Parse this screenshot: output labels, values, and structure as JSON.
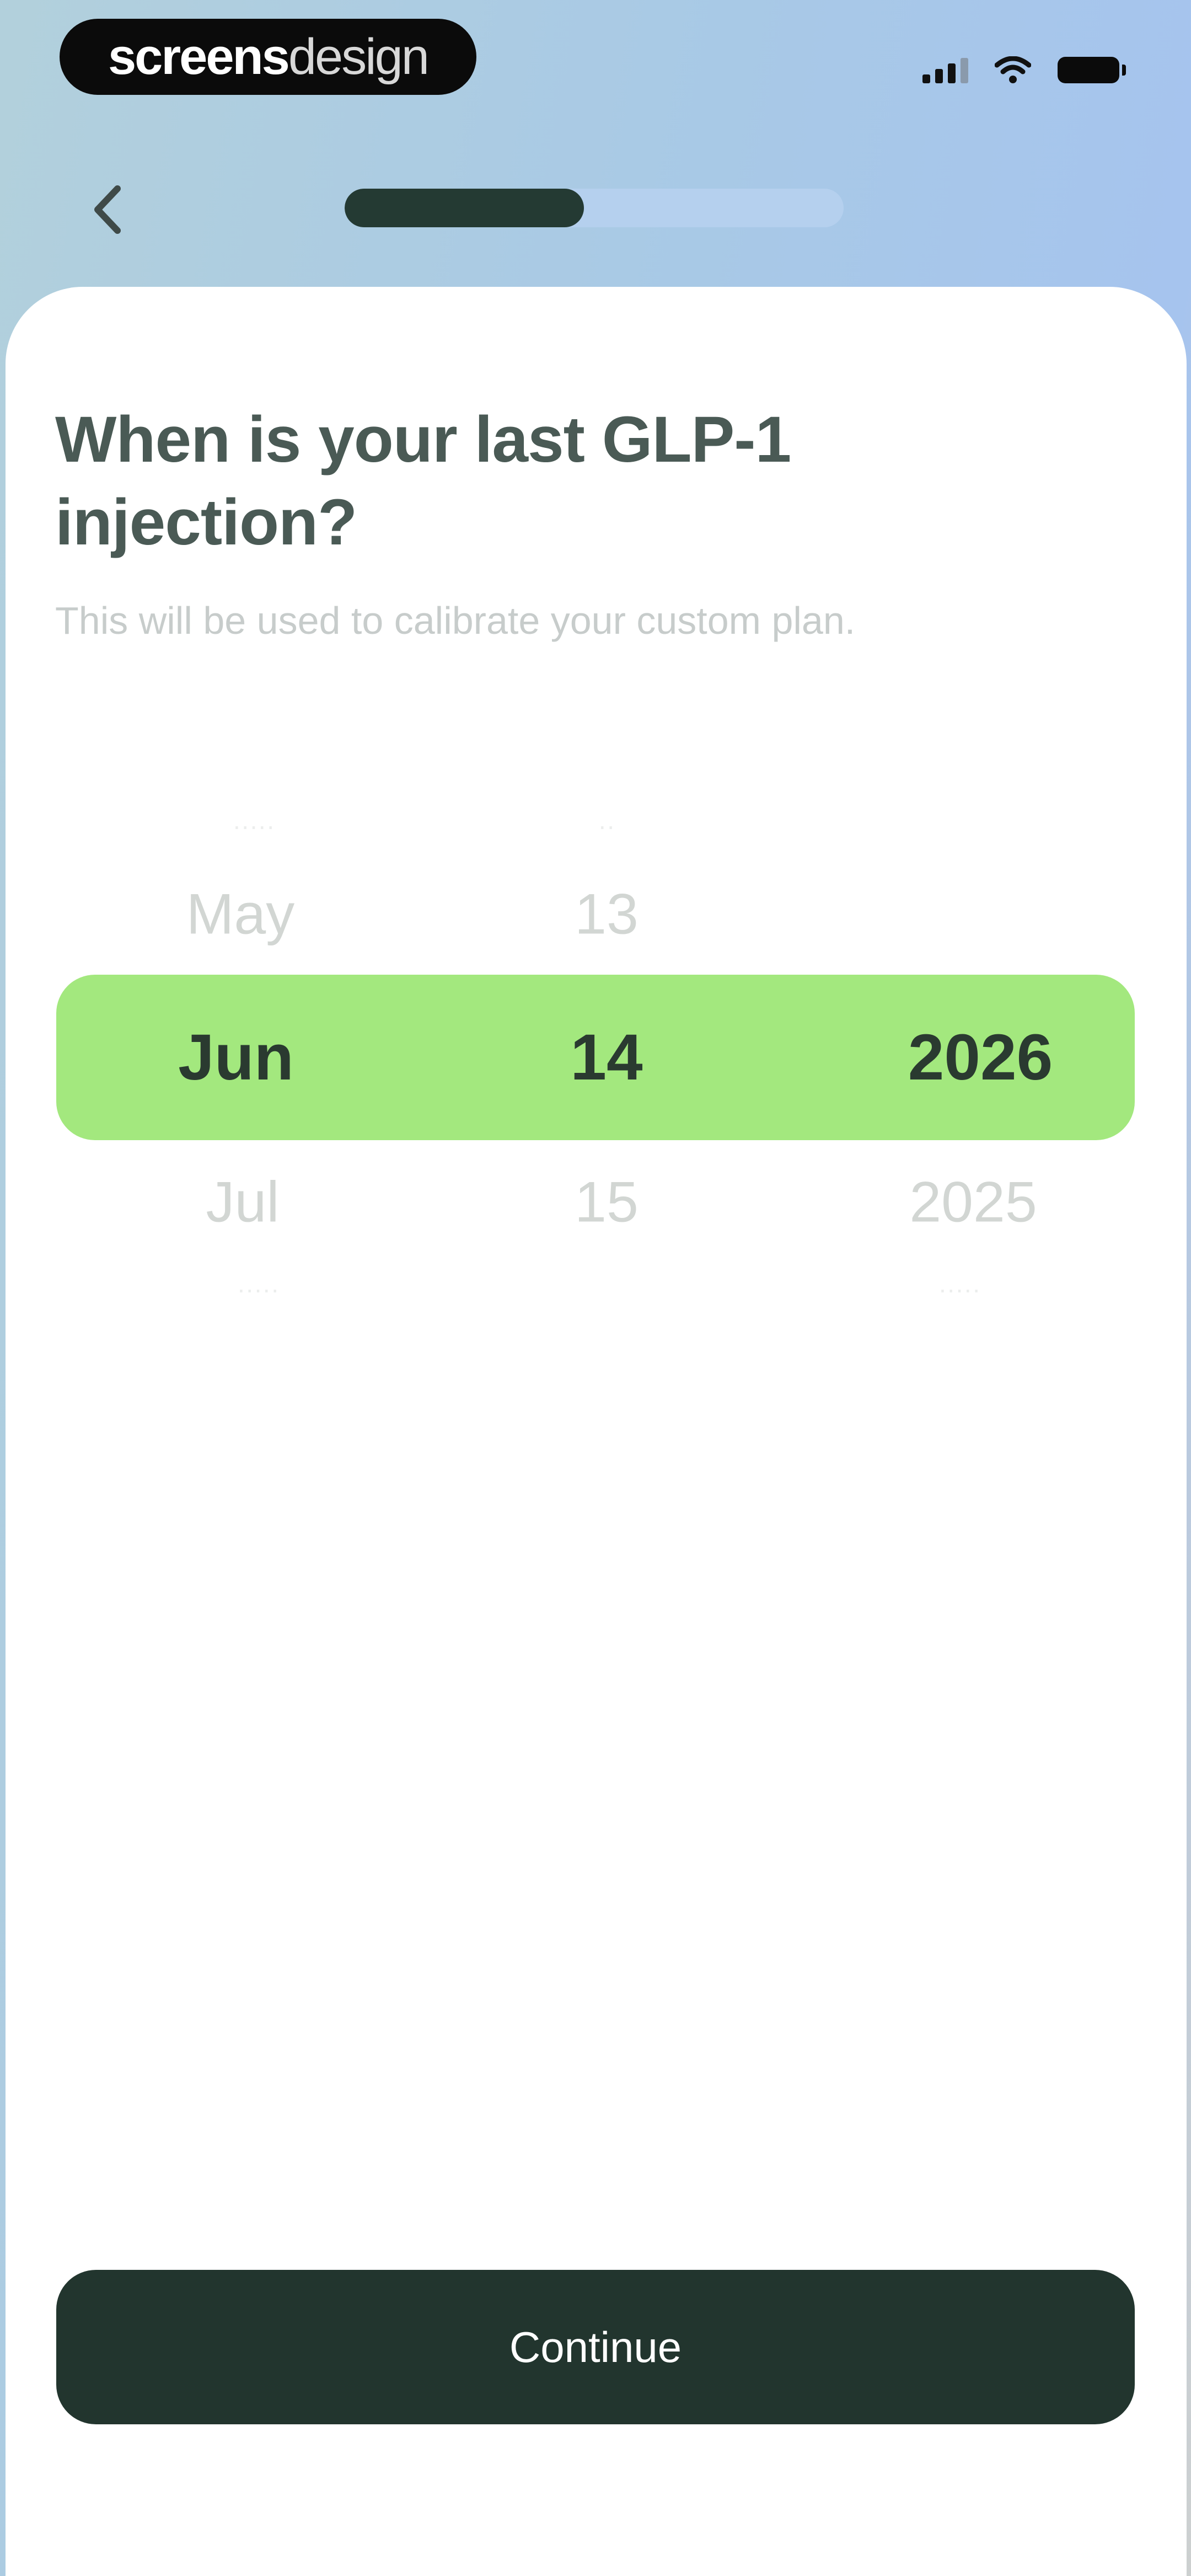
{
  "status_bar": {
    "brand_bold": "screens",
    "brand_light": "design"
  },
  "nav": {
    "back_icon": "chevron-left-icon",
    "progress_fraction": 0.48,
    "progress_colors": {
      "fill": "#243a33",
      "track": "#b5d0ee"
    }
  },
  "question": {
    "title": "When is your last GLP-1 injection?",
    "subtitle": "This will be used to calibrate your custom plan."
  },
  "picker": {
    "highlight_color": "#a3e87e",
    "month": {
      "above": "May",
      "selected": "Jun",
      "below": "Jul"
    },
    "day": {
      "above": "13",
      "selected": "14",
      "below": "15"
    },
    "year": {
      "selected": "2026",
      "below": "2025"
    }
  },
  "footer": {
    "continue_label": "Continue",
    "button_color": "#22352e"
  },
  "colors": {
    "title_text": "#4a5a55",
    "selected_text": "#2a3a30"
  }
}
